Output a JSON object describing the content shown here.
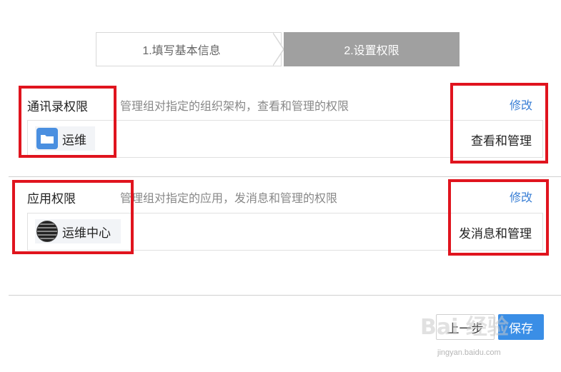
{
  "stepper": {
    "step1": "1.填写基本信息",
    "step2": "2.设置权限"
  },
  "contacts": {
    "title": "通讯录权限",
    "description": "管理组对指定的组织架构，查看和管理的权限",
    "edit": "修改",
    "item": "运维",
    "level": "查看和管理"
  },
  "apps": {
    "title": "应用权限",
    "description": "管理组对指定的应用，发消息和管理的权限",
    "edit": "修改",
    "item": "运维中心",
    "level": "发消息和管理"
  },
  "footer": {
    "prev": "上一步",
    "save": "保存"
  },
  "watermark": {
    "text": "Bai 经验",
    "url": "jingyan.baidu.com"
  },
  "colors": {
    "accent": "#3a7fd5",
    "highlight": "#e0141e",
    "step_active": "#a0a0a0"
  }
}
